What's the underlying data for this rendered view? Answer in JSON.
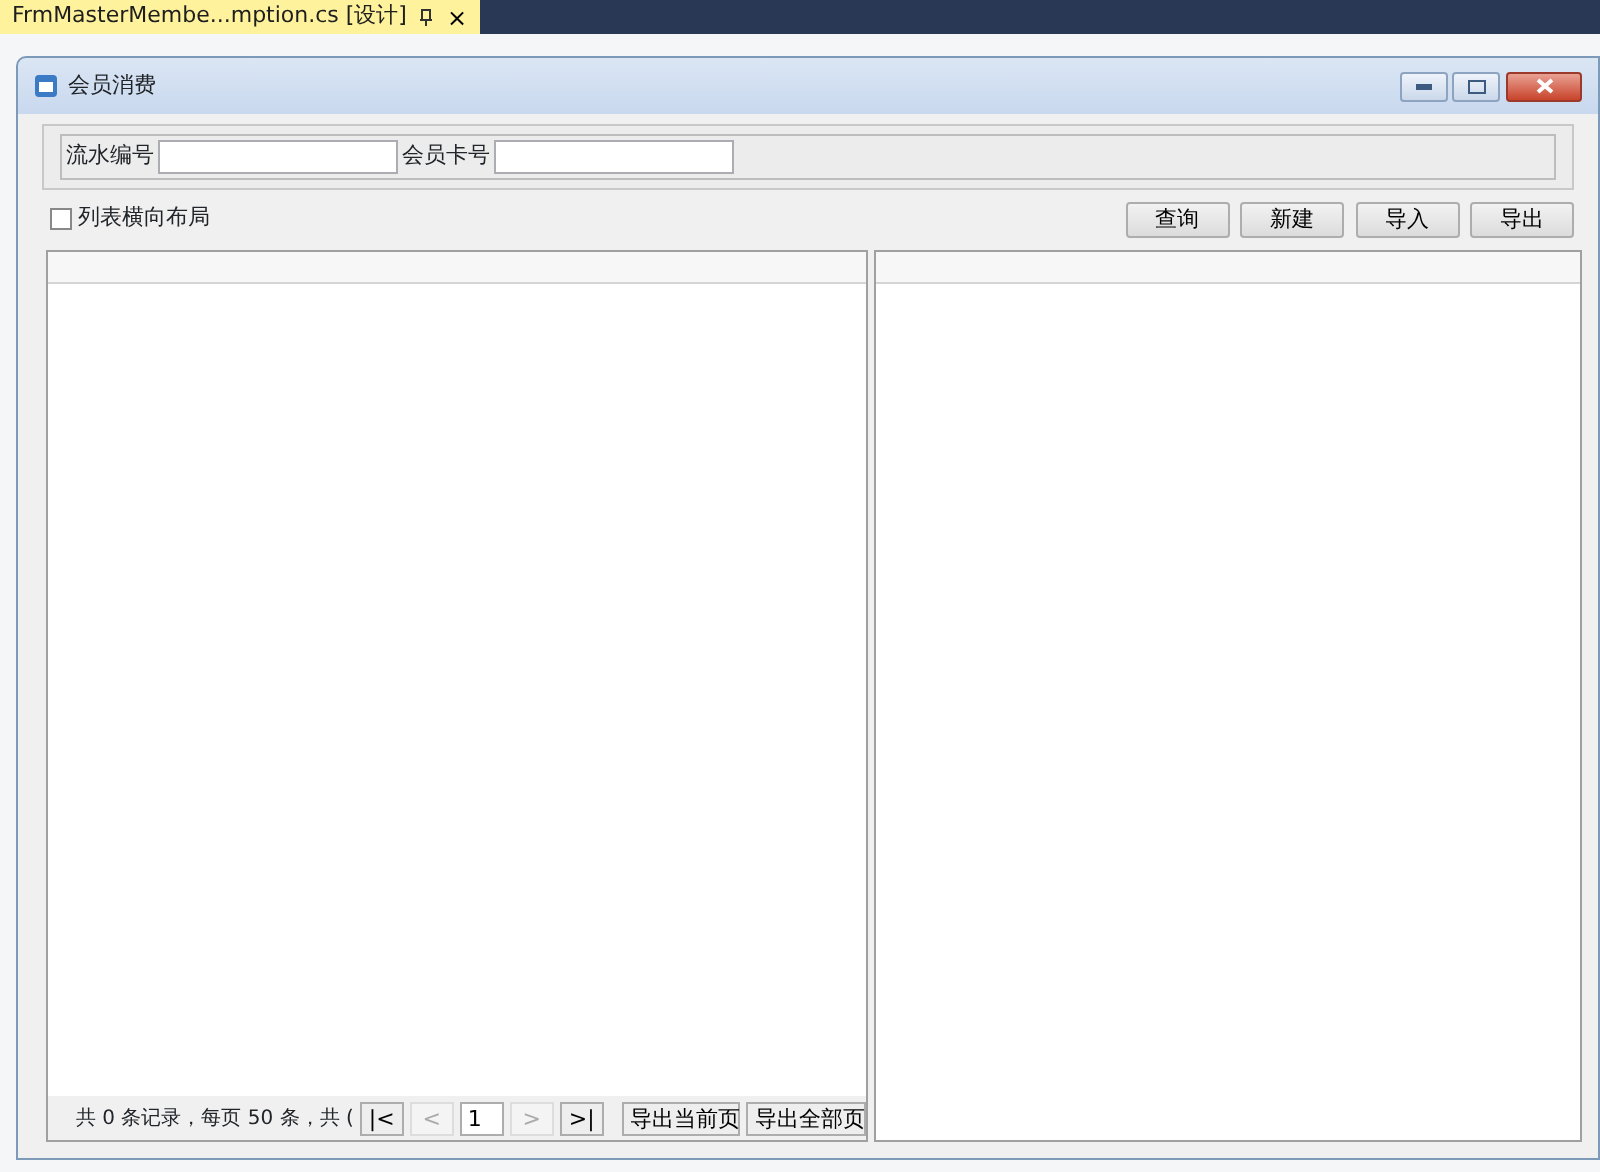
{
  "document_tab": {
    "title": "FrmMasterMembe...mption.cs [设计]",
    "close": "×"
  },
  "window": {
    "title": "会员消费"
  },
  "filters": [
    {
      "label": "流水编号"
    },
    {
      "label": "会员卡号"
    }
  ],
  "layout_option": {
    "label": "列表横向布局",
    "checked": false
  },
  "buttons": [
    "查询",
    "新建",
    "导入",
    "导出"
  ],
  "pager": {
    "summary": "共 0 条记录，每页 50 条，共 (",
    "controls": [
      {
        "label": "|<",
        "disabled": false
      },
      {
        "label": "<",
        "disabled": true
      },
      {
        "label": ">",
        "disabled": true
      },
      {
        "label": ">|",
        "disabled": false
      }
    ],
    "page": "1",
    "exports": [
      "导出当前页",
      "导出全部页"
    ]
  }
}
